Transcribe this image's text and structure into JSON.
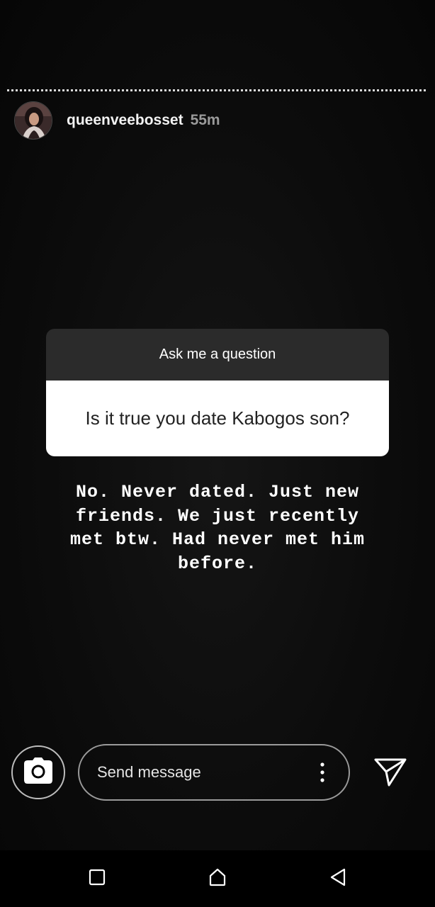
{
  "story": {
    "username": "queenveebosset",
    "time": "55m"
  },
  "question_sticker": {
    "title": "Ask me a question",
    "question": "Is it true you date Kabogos son?"
  },
  "answer": {
    "lines": [
      "No. Never dated. Just new",
      "friends. We just recently",
      "met btw. Had never met him",
      "before."
    ]
  },
  "reply_bar": {
    "placeholder": "Send message"
  },
  "icons": {
    "camera": "camera-icon",
    "more": "more-vertical-icon",
    "send": "send-icon",
    "recent": "square-icon",
    "home": "home-icon",
    "back": "triangle-back-icon"
  },
  "colors": {
    "background": "#000000",
    "card_header": "#2b2b2b",
    "card_body": "#ffffff",
    "secondary_text": "#9a9a9a"
  }
}
